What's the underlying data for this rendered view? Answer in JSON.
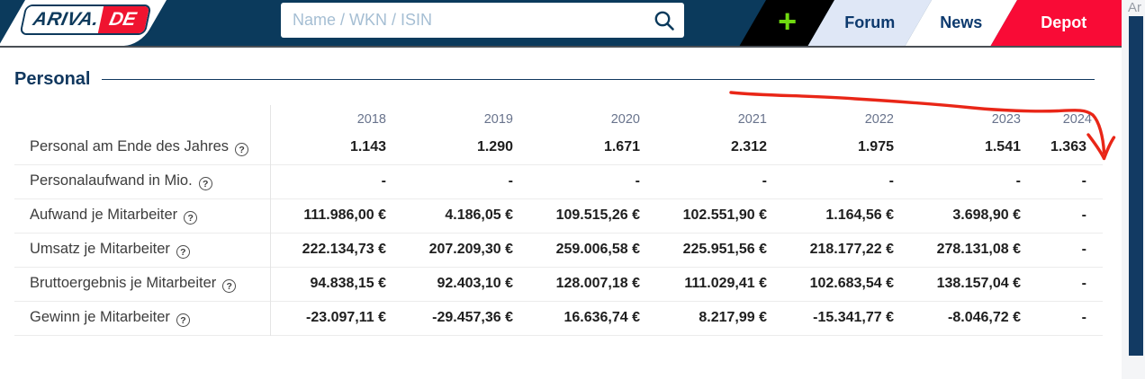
{
  "header": {
    "logo": {
      "primary": "ARIVA.",
      "secondary": "DE"
    },
    "search": {
      "placeholder": "Name / WKN / ISIN"
    },
    "nav": {
      "plus_label": "+",
      "items": [
        "Forum",
        "News",
        "Depot"
      ]
    }
  },
  "side_window": {
    "clipped_text": "Ar"
  },
  "page": {
    "section_title": "Personal"
  },
  "table": {
    "years": [
      "2018",
      "2019",
      "2020",
      "2021",
      "2022",
      "2023",
      "2024"
    ],
    "help_icon_glyph": "?",
    "rows": [
      {
        "label": "Personal am Ende des Jahres",
        "values": [
          "1.143",
          "1.290",
          "1.671",
          "2.312",
          "1.975",
          "1.541",
          "1.363"
        ]
      },
      {
        "label": "Personalaufwand in Mio.",
        "values": [
          "-",
          "-",
          "-",
          "-",
          "-",
          "-",
          "-"
        ]
      },
      {
        "label": "Aufwand je Mitarbeiter",
        "values": [
          "111.986,00 €",
          "4.186,05 €",
          "109.515,26 €",
          "102.551,90 €",
          "1.164,56 €",
          "3.698,90 €",
          "-"
        ]
      },
      {
        "label": "Umsatz je Mitarbeiter",
        "values": [
          "222.134,73 €",
          "207.209,30 €",
          "259.006,58 €",
          "225.951,56 €",
          "218.177,22 €",
          "278.131,08 €",
          "-"
        ]
      },
      {
        "label": "Bruttoergebnis je Mitarbeiter",
        "values": [
          "94.838,15 €",
          "92.403,10 €",
          "128.007,18 €",
          "111.029,41 €",
          "102.683,54 €",
          "138.157,04 €",
          "-"
        ]
      },
      {
        "label": "Gewinn je Mitarbeiter",
        "values": [
          "-23.097,11 €",
          "-29.457,36 €",
          "16.636,74 €",
          "8.217,99 €",
          "-15.341,77 €",
          "-8.046,72 €",
          "-"
        ]
      }
    ]
  },
  "colors": {
    "header_navy": "#0b3a5c",
    "brand_red": "#f90b36",
    "plus_green": "#70da10",
    "forum_bg": "#dfe7f6",
    "annotation_red": "#e92617",
    "year_text": "#68738c",
    "title_navy": "#10375e"
  }
}
